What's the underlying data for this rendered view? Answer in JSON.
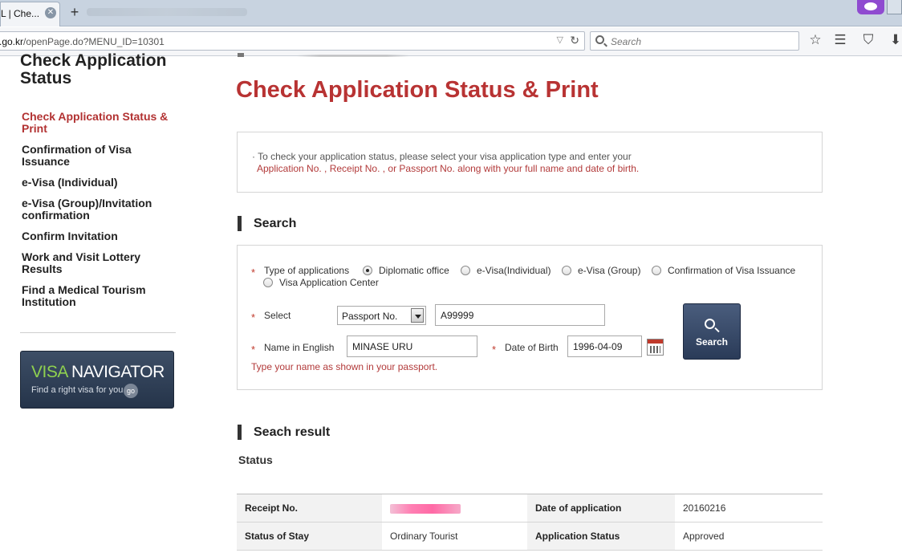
{
  "browser": {
    "tab_title": "L | Che...",
    "tab_close": "✕",
    "new_tab": "+",
    "url_domain": ".go.kr",
    "url_path": "/openPage.do?MENU_ID=10301",
    "search_placeholder": "Search"
  },
  "sidebar": {
    "title_line1": "Check Application",
    "title_line2": "Status",
    "items": [
      {
        "label": "Check Application Status & Print",
        "active": true
      },
      {
        "label": "Confirmation of Visa Issuance",
        "active": false
      },
      {
        "label": "e-Visa (Individual)",
        "active": false
      },
      {
        "label": "e-Visa (Group)/Invitation confirmation",
        "active": false
      },
      {
        "label": "Confirm Invitation",
        "active": false
      },
      {
        "label": "Work and Visit Lottery Results",
        "active": false
      },
      {
        "label": "Find a Medical Tourism Institution",
        "active": false
      }
    ],
    "banner": {
      "title_part1": "VISA",
      "title_part2": "NAVIGATOR",
      "subtitle": "Find a right visa for you",
      "go": "go"
    }
  },
  "main": {
    "title": "Check Application Status & Print",
    "info_line1": "To check your application status, please select your visa application type and enter your",
    "info_line2": "Application No. , Receipt No. , or Passport No. along with your full name and date of birth.",
    "search_heading": "Search",
    "form": {
      "type_label": "Type of applications",
      "options": [
        "Diplomatic office",
        "e-Visa(Individual)",
        "e-Visa (Group)",
        "Confirmation of Visa Issuance",
        "Visa Application Center"
      ],
      "selected_option": "Diplomatic office",
      "select_label": "Select",
      "select_value": "Passport No.",
      "number_value": "A99999",
      "name_label": "Name in English",
      "name_value": "MINASE URU",
      "dob_label": "Date of Birth",
      "dob_value": "1996-04-09",
      "hint": "Type your name as shown in your passport.",
      "search_button": "Search"
    },
    "result_heading": "Seach result",
    "status_label": "Status",
    "result_table": [
      {
        "label1": "Receipt No.",
        "value1": "",
        "label2": "Date of application",
        "value2": "20160216"
      },
      {
        "label1": "Status of Stay",
        "value1": "Ordinary Tourist",
        "label2": "Application Status",
        "value2": "Approved"
      }
    ]
  },
  "colors": {
    "accent_red": "#b83333",
    "navy_button": "#2a3b58",
    "visa_green": "#8fd14f"
  }
}
